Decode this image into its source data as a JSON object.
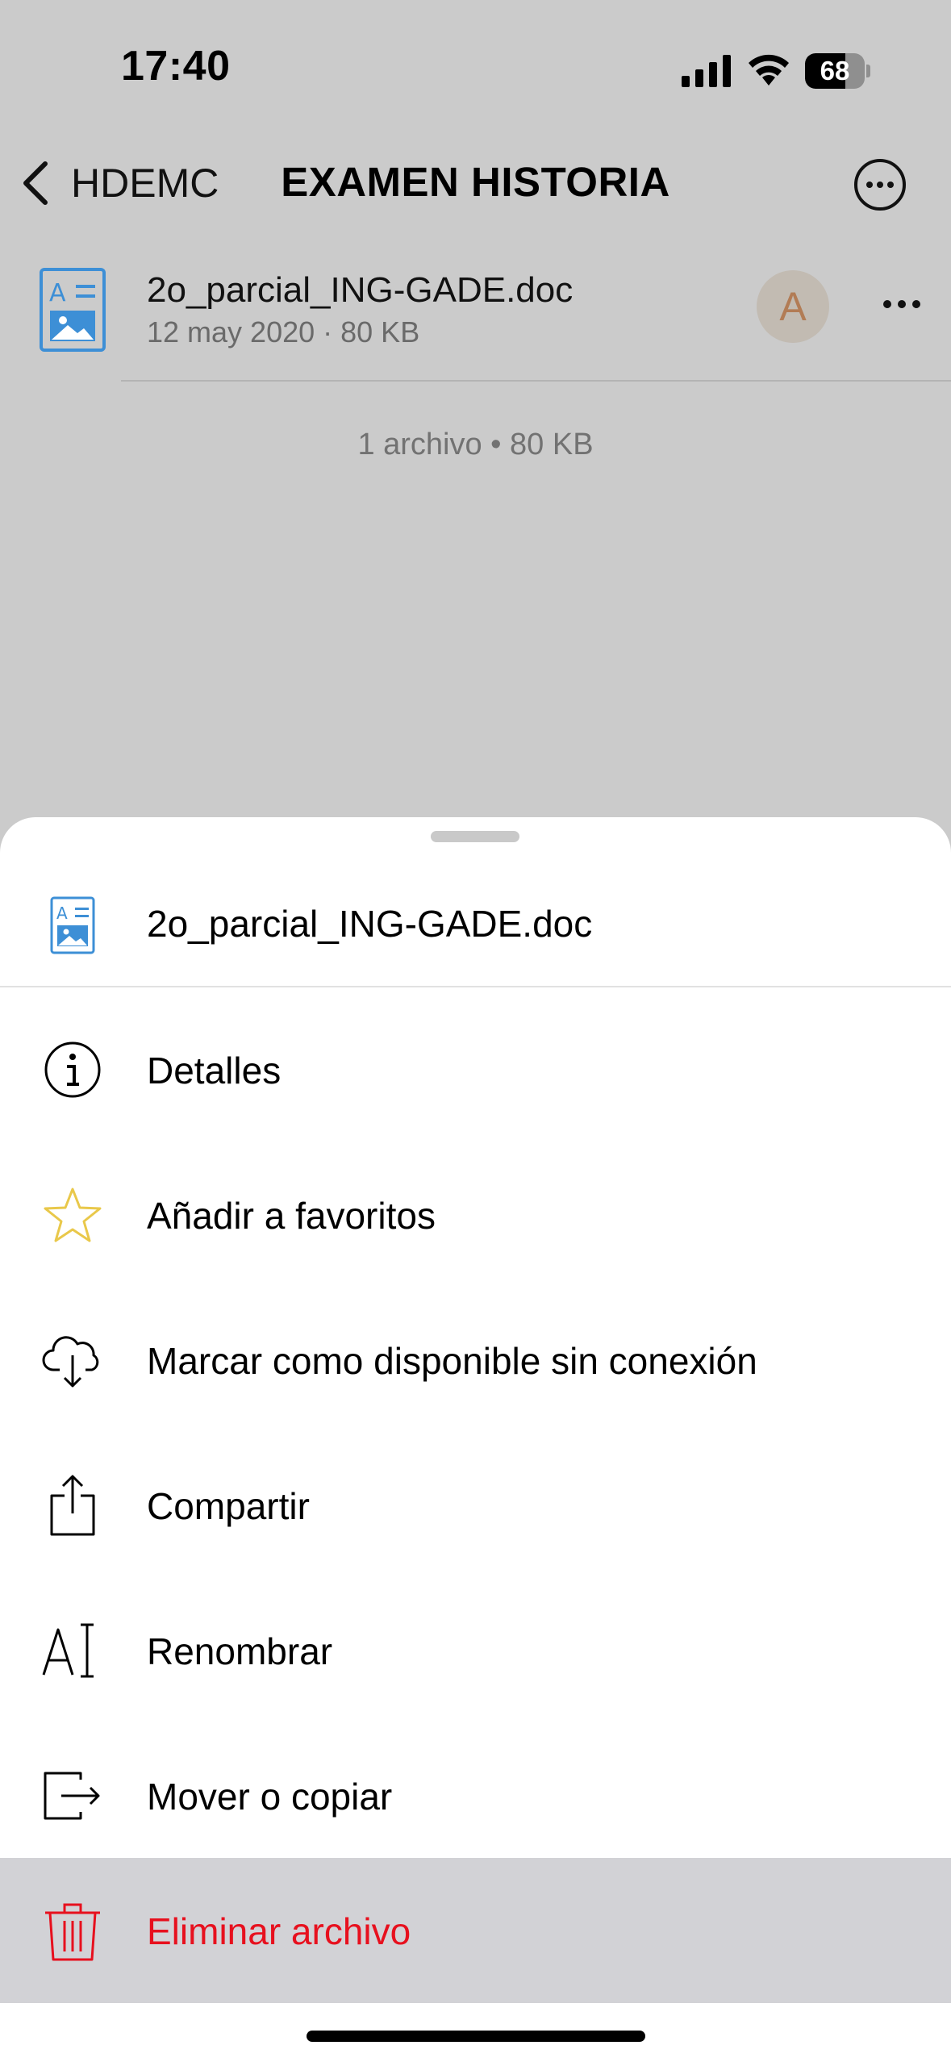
{
  "status_bar": {
    "time": "17:40",
    "battery": "68",
    "battery_level": 0.68
  },
  "nav": {
    "back_label": "HDEMC",
    "title": "EXAMEN HISTORIA"
  },
  "file": {
    "name": "2o_parcial_ING-GADE.doc",
    "meta": "12 may 2020 · 80 KB",
    "owner_initial": "A"
  },
  "summary": "1 archivo • 80 KB",
  "sheet": {
    "title": "2o_parcial_ING-GADE.doc",
    "actions": [
      {
        "label": "Detalles",
        "icon": "info-icon"
      },
      {
        "label": "Añadir a favoritos",
        "icon": "star-icon"
      },
      {
        "label": "Marcar como disponible sin conexión",
        "icon": "cloud-download-icon"
      },
      {
        "label": "Compartir",
        "icon": "share-icon"
      },
      {
        "label": "Renombrar",
        "icon": "rename-icon"
      },
      {
        "label": "Mover o copiar",
        "icon": "move-icon"
      },
      {
        "label": "Eliminar archivo",
        "icon": "trash-icon"
      }
    ]
  },
  "colors": {
    "overlay": "#cbcbcb",
    "danger": "#e7101e",
    "doc_blue": "#3d8fd6",
    "star": "#e9c84a",
    "avatar_bg": "#c2bbb2",
    "avatar_text": "#b27c55"
  }
}
